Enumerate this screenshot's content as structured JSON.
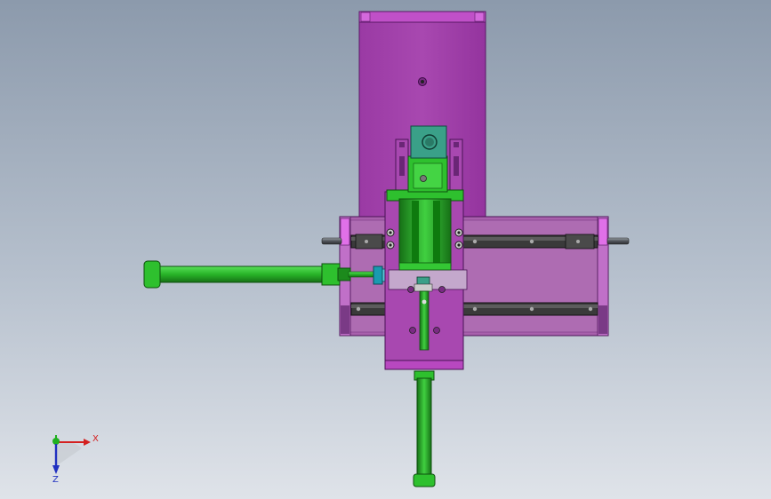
{
  "viewport": {
    "background_top": "#8c9aac",
    "background_bottom": "#dfe3e9"
  },
  "colors": {
    "purple_plate": "#a040a8",
    "purple_light": "#b070b0",
    "purple_edge": "#5a1a66",
    "magenta_cap": "#c050c8",
    "pink_end": "#e070e8",
    "green_part": "#2ec02e",
    "green_dark": "#1a7a1a",
    "teal_block": "#3aa088",
    "rail_dark": "#2a2a2a",
    "rod_gray": "#5c6066",
    "axis_x": "#d42020",
    "axis_y": "#20b020",
    "axis_z": "#2030c0"
  },
  "triad": {
    "x_label": "X",
    "z_label": "Z",
    "x_icon": "x-axis-arrow-icon",
    "y_icon": "y-axis-arrow-icon",
    "z_icon": "z-axis-arrow-icon"
  }
}
